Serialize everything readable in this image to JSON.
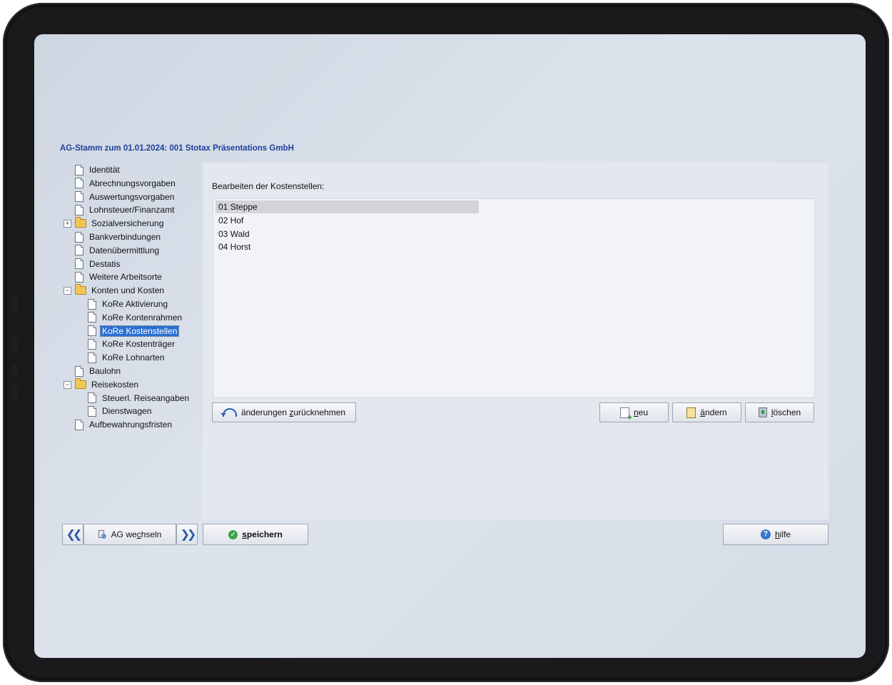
{
  "window": {
    "title": "AG-Stamm zum 01.01.2024: 001 Stotax Präsentations GmbH"
  },
  "tree": {
    "items": [
      {
        "label": "Identität",
        "type": "doc",
        "level": 0
      },
      {
        "label": "Abrechnungsvorgaben",
        "type": "doc",
        "level": 0
      },
      {
        "label": "Auswertungsvorgaben",
        "type": "doc",
        "level": 0
      },
      {
        "label": "Lohnsteuer/Finanzamt",
        "type": "doc",
        "level": 0
      },
      {
        "label": "Sozialversicherung",
        "type": "folder",
        "level": 0,
        "expander": "+"
      },
      {
        "label": "Bankverbindungen",
        "type": "doc",
        "level": 0
      },
      {
        "label": "Datenübermittlung",
        "type": "doc",
        "level": 0
      },
      {
        "label": "Destatis",
        "type": "doc",
        "level": 0
      },
      {
        "label": "Weitere Arbeitsorte",
        "type": "doc",
        "level": 0
      },
      {
        "label": "Konten und Kosten",
        "type": "folder",
        "level": 0,
        "expander": "−"
      },
      {
        "label": "KoRe Aktivierung",
        "type": "doc",
        "level": 1
      },
      {
        "label": "KoRe Kontenrahmen",
        "type": "doc",
        "level": 1
      },
      {
        "label": "KoRe Kostenstellen",
        "type": "doc",
        "level": 1,
        "selected": true
      },
      {
        "label": "KoRe Kostenträger",
        "type": "doc",
        "level": 1
      },
      {
        "label": "KoRe Lohnarten",
        "type": "doc",
        "level": 1
      },
      {
        "label": "Baulohn",
        "type": "doc",
        "level": 0
      },
      {
        "label": "Reisekosten",
        "type": "folder",
        "level": 0,
        "expander": "−"
      },
      {
        "label": "Steuerl. Reiseangaben",
        "type": "doc",
        "level": 1
      },
      {
        "label": "Dienstwagen",
        "type": "doc",
        "level": 1
      },
      {
        "label": "Aufbewahrungsfristen",
        "type": "doc",
        "level": 0
      }
    ]
  },
  "panel": {
    "label": "Bearbeiten der Kostenstellen:",
    "rows": [
      "01 Steppe",
      "02 Hof",
      "03 Wald",
      "04 Horst"
    ],
    "selected_row": 0
  },
  "buttons": {
    "undo": {
      "pre": "änderungen ",
      "u": "z",
      "post": "urücknehmen"
    },
    "new": {
      "pre": "",
      "u": "n",
      "post": "eu"
    },
    "edit": {
      "pre": "",
      "u": "ä",
      "post": "ndern"
    },
    "delete": {
      "pre": "",
      "u": "l",
      "post": "öschen"
    },
    "switch": {
      "pre": "AG we",
      "u": "c",
      "post": "hseln"
    },
    "save": {
      "pre": "",
      "u": "s",
      "post": "peichern"
    },
    "help": {
      "pre": "",
      "u": "h",
      "post": "ilfe"
    },
    "prev_icon": "double-chevron-left-icon",
    "next_icon": "double-chevron-right-icon"
  },
  "colors": {
    "title": "#203f9c",
    "selection": "#2b6fd1",
    "panel": "#e3e7ee"
  }
}
